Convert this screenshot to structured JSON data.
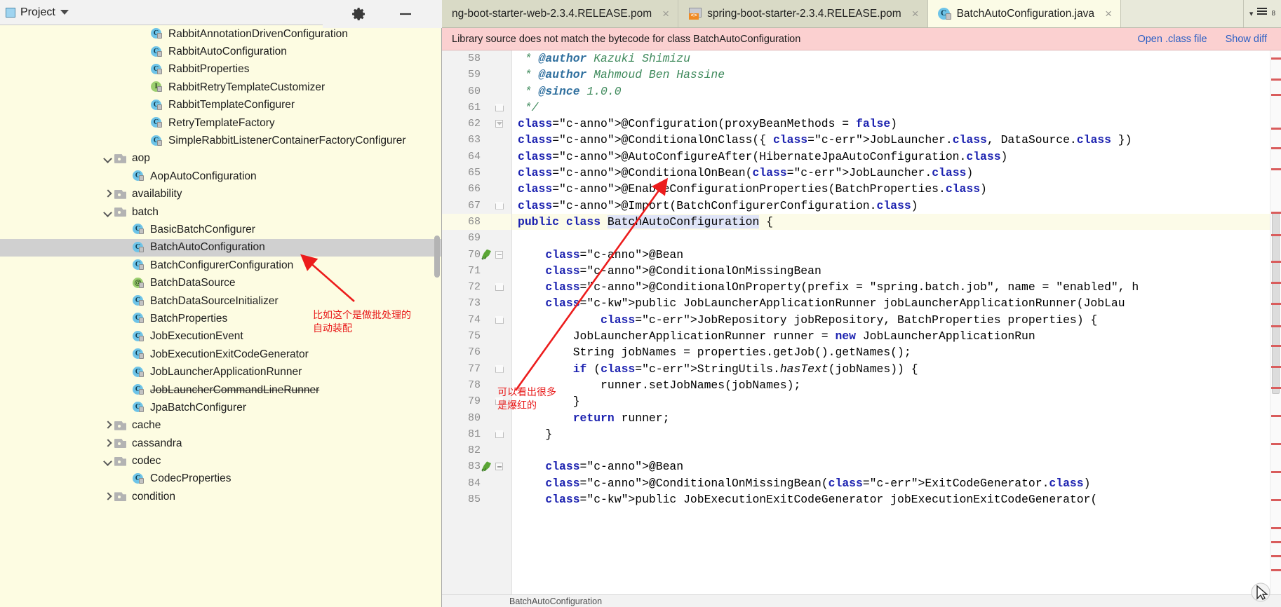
{
  "window": {
    "project_tool_title": "Project",
    "toolbar_icons": [
      "locate-target-icon",
      "collapse-all-icon",
      "settings-gear-icon",
      "minimize-icon"
    ]
  },
  "sidebar": {
    "items": [
      {
        "label": "RabbitAnnotationDrivenConfiguration",
        "icon": "java-class-icon",
        "indent": 3,
        "arrow": "none",
        "selected": false,
        "struck": false
      },
      {
        "label": "RabbitAutoConfiguration",
        "icon": "java-class-icon",
        "indent": 3,
        "arrow": "none",
        "selected": false,
        "struck": false
      },
      {
        "label": "RabbitProperties",
        "icon": "java-class-icon",
        "indent": 3,
        "arrow": "none",
        "selected": false,
        "struck": false
      },
      {
        "label": "RabbitRetryTemplateCustomizer",
        "icon": "java-interface-icon",
        "indent": 3,
        "arrow": "none",
        "selected": false,
        "struck": false
      },
      {
        "label": "RabbitTemplateConfigurer",
        "icon": "java-class-icon",
        "indent": 3,
        "arrow": "none",
        "selected": false,
        "struck": false
      },
      {
        "label": "RetryTemplateFactory",
        "icon": "java-class-icon",
        "indent": 3,
        "arrow": "none",
        "selected": false,
        "struck": false
      },
      {
        "label": "SimpleRabbitListenerContainerFactoryConfigurer",
        "icon": "java-class-icon",
        "indent": 3,
        "arrow": "none",
        "selected": false,
        "struck": false
      },
      {
        "label": "aop",
        "icon": "folder-icon",
        "indent": 1,
        "arrow": "down",
        "selected": false,
        "struck": false
      },
      {
        "label": "AopAutoConfiguration",
        "icon": "java-class-icon",
        "indent": 2,
        "arrow": "none",
        "selected": false,
        "struck": false
      },
      {
        "label": "availability",
        "icon": "folder-icon",
        "indent": 1,
        "arrow": "right",
        "selected": false,
        "struck": false
      },
      {
        "label": "batch",
        "icon": "folder-icon",
        "indent": 1,
        "arrow": "down",
        "selected": false,
        "struck": false
      },
      {
        "label": "BasicBatchConfigurer",
        "icon": "java-class-icon",
        "indent": 2,
        "arrow": "none",
        "selected": false,
        "struck": false
      },
      {
        "label": "BatchAutoConfiguration",
        "icon": "java-class-icon",
        "indent": 2,
        "arrow": "none",
        "selected": true,
        "struck": false
      },
      {
        "label": "BatchConfigurerConfiguration",
        "icon": "java-class-icon",
        "indent": 2,
        "arrow": "none",
        "selected": false,
        "struck": false
      },
      {
        "label": "BatchDataSource",
        "icon": "java-annotation-icon",
        "indent": 2,
        "arrow": "none",
        "selected": false,
        "struck": false
      },
      {
        "label": "BatchDataSourceInitializer",
        "icon": "java-class-icon",
        "indent": 2,
        "arrow": "none",
        "selected": false,
        "struck": false
      },
      {
        "label": "BatchProperties",
        "icon": "java-class-icon",
        "indent": 2,
        "arrow": "none",
        "selected": false,
        "struck": false
      },
      {
        "label": "JobExecutionEvent",
        "icon": "java-class-icon",
        "indent": 2,
        "arrow": "none",
        "selected": false,
        "struck": false
      },
      {
        "label": "JobExecutionExitCodeGenerator",
        "icon": "java-class-icon",
        "indent": 2,
        "arrow": "none",
        "selected": false,
        "struck": false
      },
      {
        "label": "JobLauncherApplicationRunner",
        "icon": "java-class-icon",
        "indent": 2,
        "arrow": "none",
        "selected": false,
        "struck": false
      },
      {
        "label": "JobLauncherCommandLineRunner",
        "icon": "java-class-icon",
        "indent": 2,
        "arrow": "none",
        "selected": false,
        "struck": true
      },
      {
        "label": "JpaBatchConfigurer",
        "icon": "java-class-icon",
        "indent": 2,
        "arrow": "none",
        "selected": false,
        "struck": false
      },
      {
        "label": "cache",
        "icon": "folder-icon",
        "indent": 1,
        "arrow": "right",
        "selected": false,
        "struck": false
      },
      {
        "label": "cassandra",
        "icon": "folder-icon",
        "indent": 1,
        "arrow": "right",
        "selected": false,
        "struck": false
      },
      {
        "label": "codec",
        "icon": "folder-icon",
        "indent": 1,
        "arrow": "down",
        "selected": false,
        "struck": false
      },
      {
        "label": "CodecProperties",
        "icon": "java-class-icon",
        "indent": 2,
        "arrow": "none",
        "selected": false,
        "struck": false
      },
      {
        "label": "condition",
        "icon": "folder-icon",
        "indent": 1,
        "arrow": "right",
        "selected": false,
        "struck": false
      }
    ]
  },
  "tabs": [
    {
      "label": "ng-boot-starter-web-2.3.4.RELEASE.pom",
      "icon": "none",
      "active": false,
      "close": "×"
    },
    {
      "label": "spring-boot-starter-2.3.4.RELEASE.pom",
      "icon": "pom-file-icon",
      "active": false,
      "close": "×"
    },
    {
      "label": "BatchAutoConfiguration.java",
      "icon": "java-class-icon",
      "active": true,
      "close": "×"
    }
  ],
  "notification": {
    "message": "Library source does not match the bytecode for class BatchAutoConfiguration",
    "open_class_file": "Open .class file",
    "show_diff": "Show diff"
  },
  "editor": {
    "first_line": 58,
    "lines": [
      {
        "n": 58,
        "fold": "none",
        "hl": false,
        "bean": false
      },
      {
        "n": 59,
        "fold": "none",
        "hl": false,
        "bean": false
      },
      {
        "n": 60,
        "fold": "none",
        "hl": false,
        "bean": false
      },
      {
        "n": 61,
        "fold": "house",
        "hl": false,
        "bean": false
      },
      {
        "n": 62,
        "fold": "tri-down",
        "hl": false,
        "bean": false
      },
      {
        "n": 63,
        "fold": "none",
        "hl": false,
        "bean": false
      },
      {
        "n": 64,
        "fold": "none",
        "hl": false,
        "bean": false
      },
      {
        "n": 65,
        "fold": "none",
        "hl": false,
        "bean": false
      },
      {
        "n": 66,
        "fold": "none",
        "hl": false,
        "bean": false
      },
      {
        "n": 67,
        "fold": "house",
        "hl": false,
        "bean": false
      },
      {
        "n": 68,
        "fold": "none",
        "hl": true,
        "bean": false
      },
      {
        "n": 69,
        "fold": "none",
        "hl": false,
        "bean": false
      },
      {
        "n": 70,
        "fold": "dash",
        "hl": false,
        "bean": true
      },
      {
        "n": 71,
        "fold": "none",
        "hl": false,
        "bean": false
      },
      {
        "n": 72,
        "fold": "house",
        "hl": false,
        "bean": false
      },
      {
        "n": 73,
        "fold": "none",
        "hl": false,
        "bean": false
      },
      {
        "n": 74,
        "fold": "house",
        "hl": false,
        "bean": false
      },
      {
        "n": 75,
        "fold": "none",
        "hl": false,
        "bean": false
      },
      {
        "n": 76,
        "fold": "none",
        "hl": false,
        "bean": false
      },
      {
        "n": 77,
        "fold": "house",
        "hl": false,
        "bean": false
      },
      {
        "n": 78,
        "fold": "none",
        "hl": false,
        "bean": false
      },
      {
        "n": 79,
        "fold": "house",
        "hl": false,
        "bean": false
      },
      {
        "n": 80,
        "fold": "none",
        "hl": false,
        "bean": false
      },
      {
        "n": 81,
        "fold": "house",
        "hl": false,
        "bean": false
      },
      {
        "n": 82,
        "fold": "none",
        "hl": false,
        "bean": false
      },
      {
        "n": 83,
        "fold": "dash",
        "hl": false,
        "bean": true
      },
      {
        "n": 84,
        "fold": "none",
        "hl": false,
        "bean": false
      },
      {
        "n": 85,
        "fold": "none",
        "hl": false,
        "bean": false
      }
    ],
    "code_text": [
      " * @author Kazuki Shimizu",
      " * @author Mahmoud Ben Hassine",
      " * @since 1.0.0",
      " */",
      "@Configuration(proxyBeanMethods = false)",
      "@ConditionalOnClass({ JobLauncher.class, DataSource.class })",
      "@AutoConfigureAfter(HibernateJpaAutoConfiguration.class)",
      "@ConditionalOnBean(JobLauncher.class)",
      "@EnableConfigurationProperties(BatchProperties.class)",
      "@Import(BatchConfigurerConfiguration.class)",
      "public class BatchAutoConfiguration {",
      "",
      "    @Bean",
      "    @ConditionalOnMissingBean",
      "    @ConditionalOnProperty(prefix = \"spring.batch.job\", name = \"enabled\", h",
      "    public JobLauncherApplicationRunner jobLauncherApplicationRunner(JobLau",
      "            JobRepository jobRepository, BatchProperties properties) {",
      "        JobLauncherApplicationRunner runner = new JobLauncherApplicationRun",
      "        String jobNames = properties.getJob().getNames();",
      "        if (StringUtils.hasText(jobNames)) {",
      "            runner.setJobNames(jobNames);",
      "        }",
      "        return runner;",
      "    }",
      "",
      "    @Bean",
      "    @ConditionalOnMissingBean(ExitCodeGenerator.class)",
      "    public JobExecutionExitCodeGenerator jobExecutionExitCodeGenerator("
    ]
  },
  "annotations": [
    {
      "id": "annot-1",
      "text": "比如这个是做批处理的\n自动装配",
      "color": "#e81919"
    },
    {
      "id": "annot-2",
      "text": "可以看出很多\n是爆红的",
      "color": "#e81919"
    }
  ],
  "status_bar": {
    "breadcrumb": "BatchAutoConfiguration"
  },
  "colors": {
    "sidebar_bg": "#fdfce2",
    "selection": "#d0d0d0",
    "notification_bg": "#fbd0d0",
    "annotation_red": "#e81919",
    "tab_active_bg": "#fbfbe6"
  }
}
